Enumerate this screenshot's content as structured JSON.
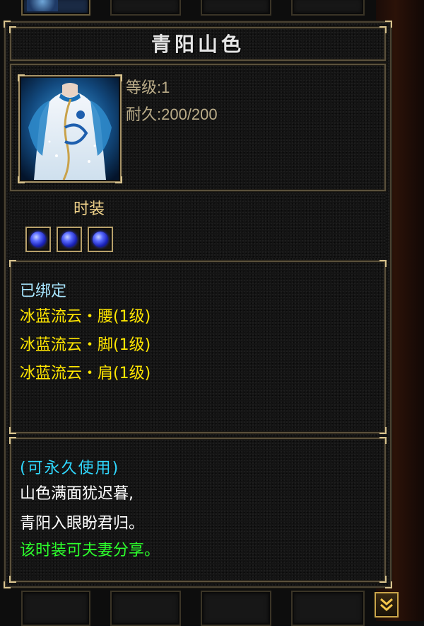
{
  "item": {
    "name": "青阳山色",
    "level_label": "等级:1",
    "durability_label": "耐久:200/200",
    "category": "时装",
    "gem_icons": [
      "blue-orb-gem-icon",
      "blue-orb-gem-icon",
      "blue-orb-gem-icon"
    ],
    "portrait_icon": "fashion-qipao-portrait-icon"
  },
  "attributes": {
    "bound": "已绑定",
    "sets": [
      "冰蓝流云・腰(1级)",
      "冰蓝流云・脚(1级)",
      "冰蓝流云・肩(1级)"
    ]
  },
  "description": {
    "usage": "(可永久使用)",
    "lines": [
      "山色满面犹迟暮,",
      "青阳入眼盼君归。"
    ],
    "note": "该时装可夫妻分享。"
  },
  "colors": {
    "title": "#e6e6e6",
    "stat_text": "#b9ab88",
    "category": "#f0d28a",
    "bound": "#a8e6ff",
    "set_items": "#ffe600",
    "usage": "#2fd8ff",
    "poem": "#ffffff",
    "note": "#2cff2c",
    "frame": "#5a503b",
    "corner": "#d8c38e"
  }
}
